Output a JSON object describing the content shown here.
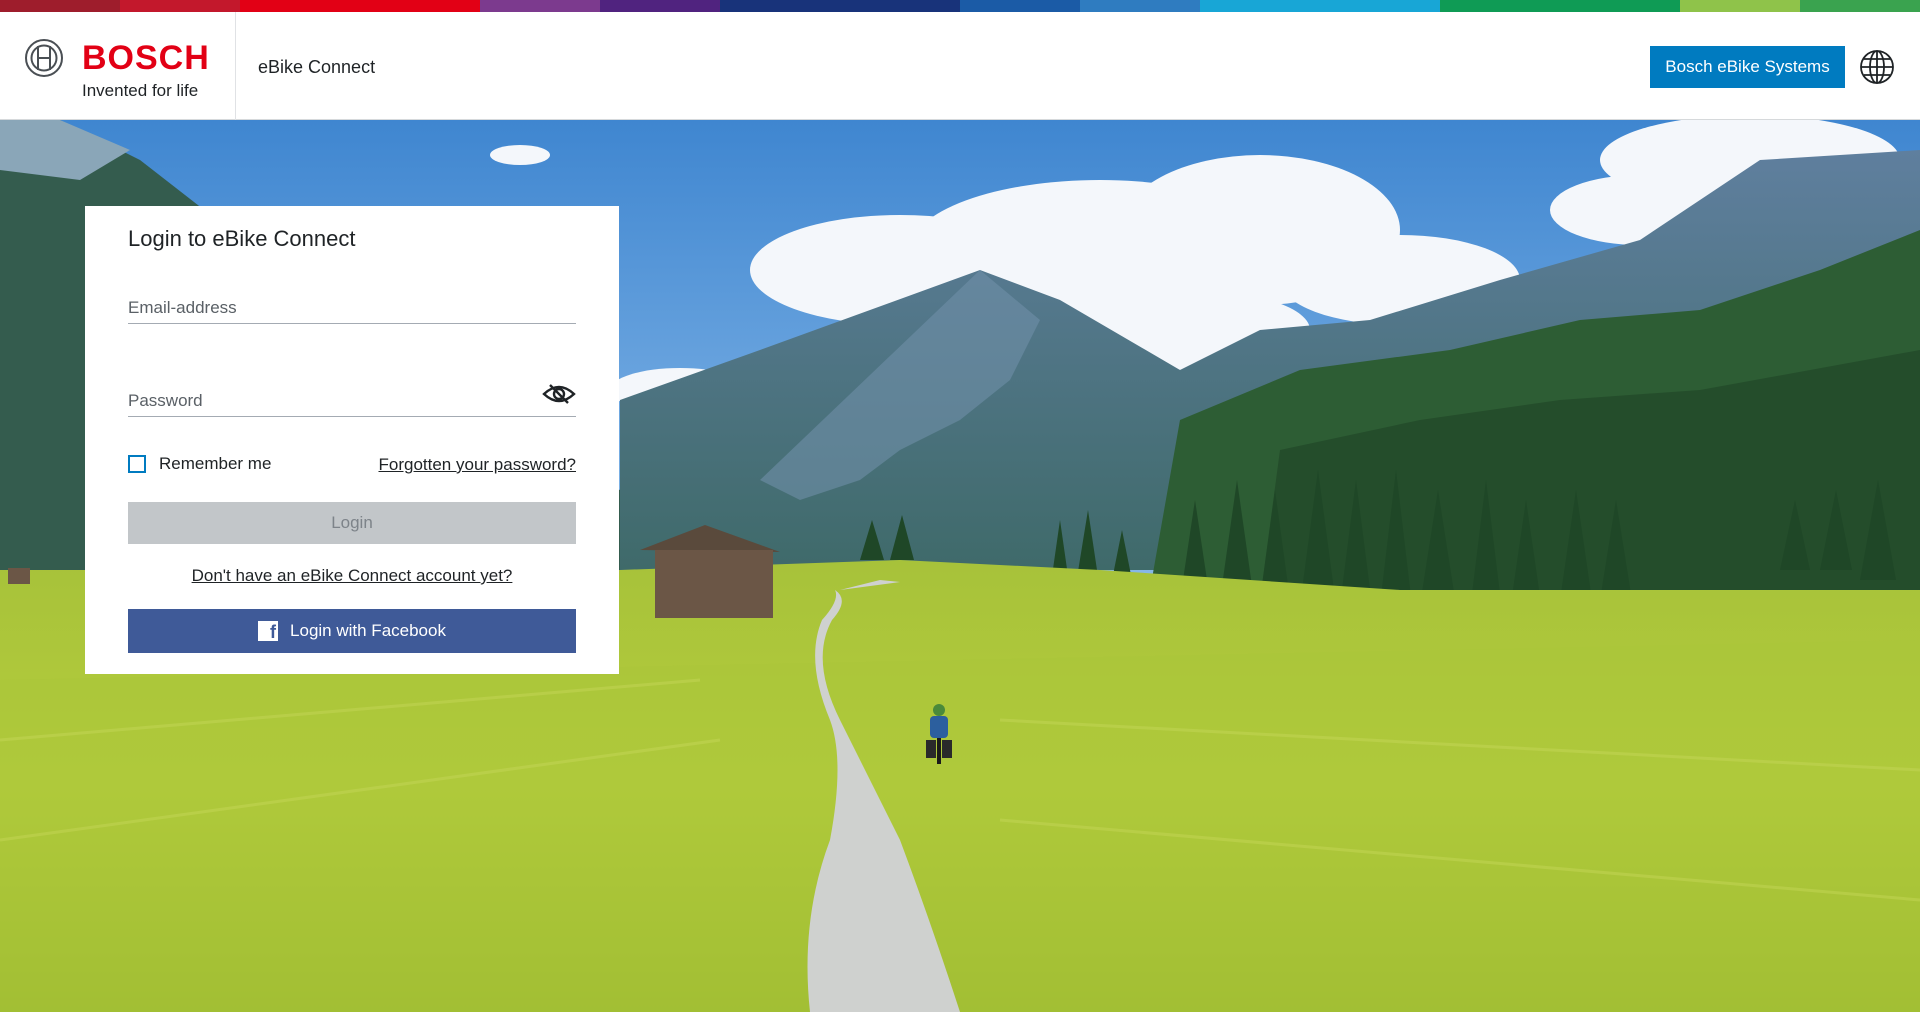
{
  "header": {
    "brand_name": "BOSCH",
    "brand_tagline": "Invented for life",
    "app_name": "eBike Connect",
    "systems_button": "Bosch eBike Systems",
    "language_icon": "globe-icon",
    "logo_icon": "bosch-armature-icon"
  },
  "colors": {
    "stripe": [
      "#9e1d2c",
      "#c3182c",
      "#e20015",
      "#7c3a8e",
      "#50237f",
      "#18337a",
      "#1b5ba6",
      "#2f7cc0",
      "#18a6d6",
      "#0f9b55",
      "#8fc34a",
      "#3aa34f"
    ],
    "brand_red": "#e20015",
    "primary_blue": "#007bc0",
    "facebook_blue": "#3f5a98",
    "disabled_gray": "#c2c6c9"
  },
  "login": {
    "title": "Login to eBike Connect",
    "email_placeholder": "Email-address",
    "email_value": "",
    "password_placeholder": "Password",
    "password_value": "",
    "show_password_icon": "eye-icon",
    "remember_me": "Remember me",
    "remember_checked": false,
    "forgot_password": "Forgotten your password?",
    "login_button": "Login",
    "no_account": "Don't have an eBike Connect account yet?",
    "facebook_button": "Login with Facebook",
    "facebook_icon": "facebook-icon"
  }
}
